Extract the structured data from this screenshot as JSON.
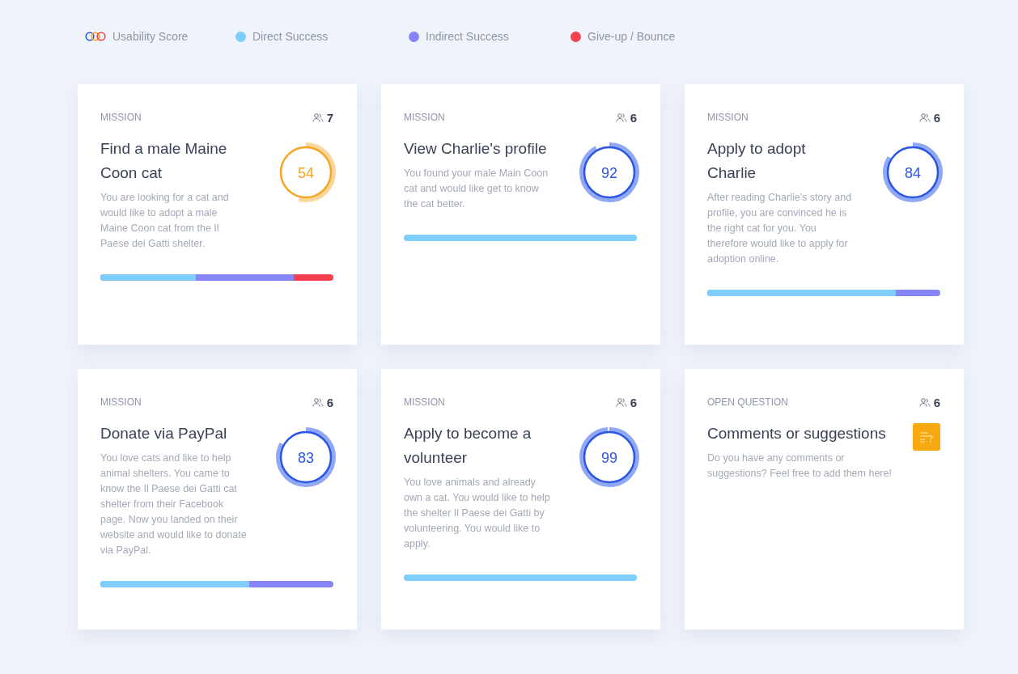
{
  "legend": [
    {
      "kind": "score",
      "label": "Usability Score"
    },
    {
      "kind": "dot",
      "label": "Direct Success",
      "color": "#7fcdfb"
    },
    {
      "kind": "dot",
      "label": "Indirect Success",
      "color": "#8585f7"
    },
    {
      "kind": "dot",
      "label": "Give-up / Bounce",
      "color": "#f5414f"
    }
  ],
  "cards": [
    {
      "kind": "mission",
      "label": "MISSION",
      "participants": "7",
      "title": "Find a male Maine Coon cat",
      "description": "You are looking for a cat and would like to adopt a male Maine Coon cat from the Il Paese dei Gatti shelter.",
      "score": {
        "value": "54",
        "color": "#f5a623"
      },
      "bar": [
        {
          "kind": "direct",
          "level": 0.41
        },
        {
          "kind": "indirect",
          "level": 0.83
        },
        {
          "kind": "giveup",
          "level": 1
        }
      ]
    },
    {
      "kind": "mission",
      "label": "MISSION",
      "participants": "6",
      "title": "View Charlie's profile",
      "description": "You found your male Main Coon cat and would like get to know the cat better.",
      "score": {
        "value": "92",
        "color": "#2a55e5"
      },
      "bar": [
        {
          "kind": "direct",
          "level": 1
        }
      ]
    },
    {
      "kind": "mission",
      "label": "MISSION",
      "participants": "6",
      "title": "Apply to adopt Charlie",
      "description": "After reading Charlie's story and profile, you are convinced he is the right cat for you. You therefore would like to apply for adoption online.",
      "score": {
        "value": "84",
        "color": "#2a55e5"
      },
      "bar": [
        {
          "kind": "direct",
          "level": 0.81
        },
        {
          "kind": "indirect",
          "level": 1
        }
      ]
    },
    {
      "kind": "mission",
      "label": "MISSION",
      "participants": "6",
      "title": "Donate via PayPal",
      "description": "You love cats and like to help animal shelters. You came to know the Il Paese dei Gatti cat shelter from their Facebook page. Now you landed on their website and would like to donate via PayPal.",
      "score": {
        "value": "83",
        "color": "#2a55e5"
      },
      "bar": [
        {
          "kind": "direct",
          "level": 0.64
        },
        {
          "kind": "indirect",
          "level": 1
        }
      ]
    },
    {
      "kind": "mission",
      "label": "MISSION",
      "participants": "6",
      "title": "Apply to become a volunteer",
      "description": "You love animals and already own a cat. You would like to help the shelter Il Paese dei Gatti by volunteering. You would like to apply.",
      "score": {
        "value": "99",
        "color": "#2a55e5"
      },
      "bar": [
        {
          "kind": "direct",
          "level": 1
        }
      ]
    },
    {
      "kind": "question",
      "label": "OPEN QUESTION",
      "participants": "6",
      "title": "Comments or suggestions",
      "description": "Do you have any comments or suggestions? Feel free to add them here!"
    }
  ]
}
